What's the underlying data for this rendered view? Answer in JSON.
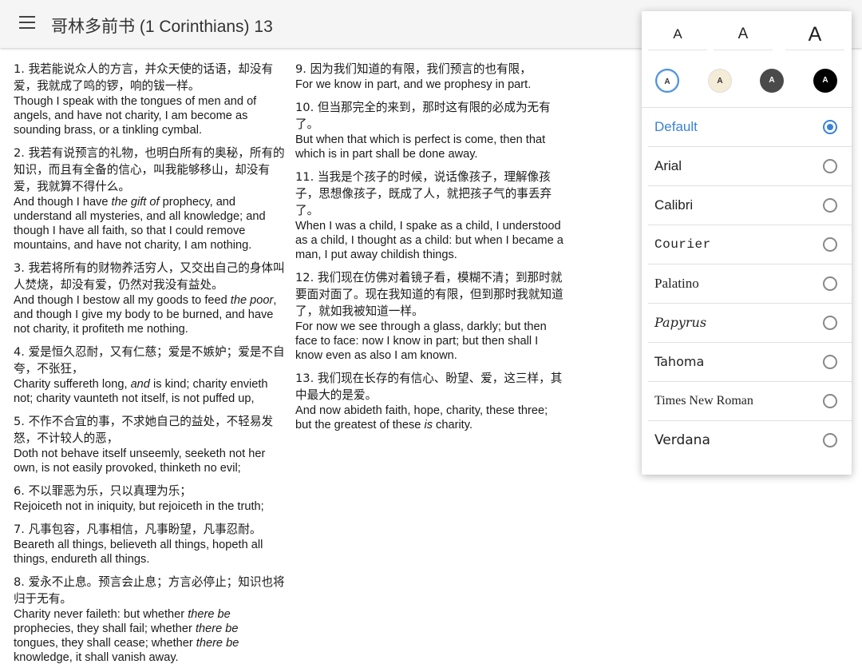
{
  "header": {
    "title": "哥林多前书 (1 Corinthians) 13"
  },
  "verses": {
    "v1": {
      "zh": "1. 我若能说众人的方言，并众天使的话语，却没有爱，我就成了鸣的锣，响的钹一样。",
      "en": "Though I speak with the tongues of men and of angels, and have not charity, I am become as sounding brass, or a tinkling cymbal."
    },
    "v2": {
      "zh": "2. 我若有说预言的礼物，也明白所有的奥秘，所有的知识，而且有全备的信心，叫我能够移山，却没有爱，我就算不得什么。",
      "en": [
        "And though I have ",
        "the gift of",
        " prophecy, and understand all mysteries, and all knowledge; and though I have all faith, so that I could remove mountains, and have not charity, I am nothing."
      ]
    },
    "v3": {
      "zh": "3. 我若将所有的财物养活穷人，又交出自己的身体叫人焚烧，却没有爱，仍然对我没有益处。",
      "en": [
        "And though I bestow all my goods to feed ",
        "the poor",
        ", and though I give my body to be burned, and have not charity, it profiteth me nothing."
      ]
    },
    "v4": {
      "zh": "4. 爱是恒久忍耐，又有仁慈；爱是不嫉妒；爱是不自夸，不张狂，",
      "en": [
        "Charity suffereth long, ",
        "and",
        " is kind; charity envieth not; charity vaunteth not itself, is not puffed up,"
      ]
    },
    "v5": {
      "zh": "5. 不作不合宜的事，不求她自己的益处，不轻易发怒，不计较人的恶，",
      "en": "Doth not behave itself unseemly, seeketh not her own, is not easily provoked, thinketh no evil;"
    },
    "v6": {
      "zh": "6. 不以罪恶为乐，只以真理为乐；",
      "en": "Rejoiceth not in iniquity, but rejoiceth in the truth;"
    },
    "v7": {
      "zh": "7. 凡事包容，凡事相信，凡事盼望，凡事忍耐。",
      "en": "Beareth all things, believeth all things, hopeth all things, endureth all things."
    },
    "v8": {
      "zh": "8. 爱永不止息。预言会止息；方言必停止；知识也将归于无有。",
      "en": [
        "Charity never faileth: but whether ",
        "there be",
        " prophecies, they shall fail; whether ",
        "there be",
        " tongues, they shall cease; whether ",
        "there be",
        " knowledge, it shall vanish away."
      ]
    },
    "v9": {
      "zh": "9. 因为我们知道的有限，我们预言的也有限，",
      "en": "For we know in part, and we prophesy in part."
    },
    "v10": {
      "zh": "10. 但当那完全的来到，那时这有限的必成为无有了。",
      "en": "But when that which is perfect is come, then that which is in part shall be done away."
    },
    "v11": {
      "zh": "11. 当我是个孩子的时候，说话像孩子，理解像孩子，思想像孩子，既成了人，就把孩子气的事丢弃了。",
      "en": "When I was a child, I spake as a child, I understood as a child, I thought as a child: but when I became a man, I put away childish things."
    },
    "v12": {
      "zh": "12. 我们现在仿佛对着镜子看，模糊不清；到那时就要面对面了。现在我知道的有限，但到那时我就知道了，就如我被知道一样。",
      "en": "For now we see through a glass, darkly; but then face to face: now I know in part; but then shall I know even as also I am known."
    },
    "v13": {
      "zh": "13. 我们现在长存的有信心、盼望、爱，这三样，其中最大的是爱。",
      "en": [
        "And now abideth faith, hope, charity, these three; but the greatest of these ",
        "is",
        " charity."
      ]
    }
  },
  "settings": {
    "font_sizes": [
      "A",
      "A",
      "A"
    ],
    "themes": [
      "A",
      "A",
      "A",
      "A"
    ],
    "fonts": [
      "Default",
      "Arial",
      "Calibri",
      "Courier",
      "Palatino",
      "Papyrus",
      "Tahoma",
      "Times New Roman",
      "Verdana"
    ],
    "selected_font": "Default",
    "accent_color": "#3b82d6"
  }
}
